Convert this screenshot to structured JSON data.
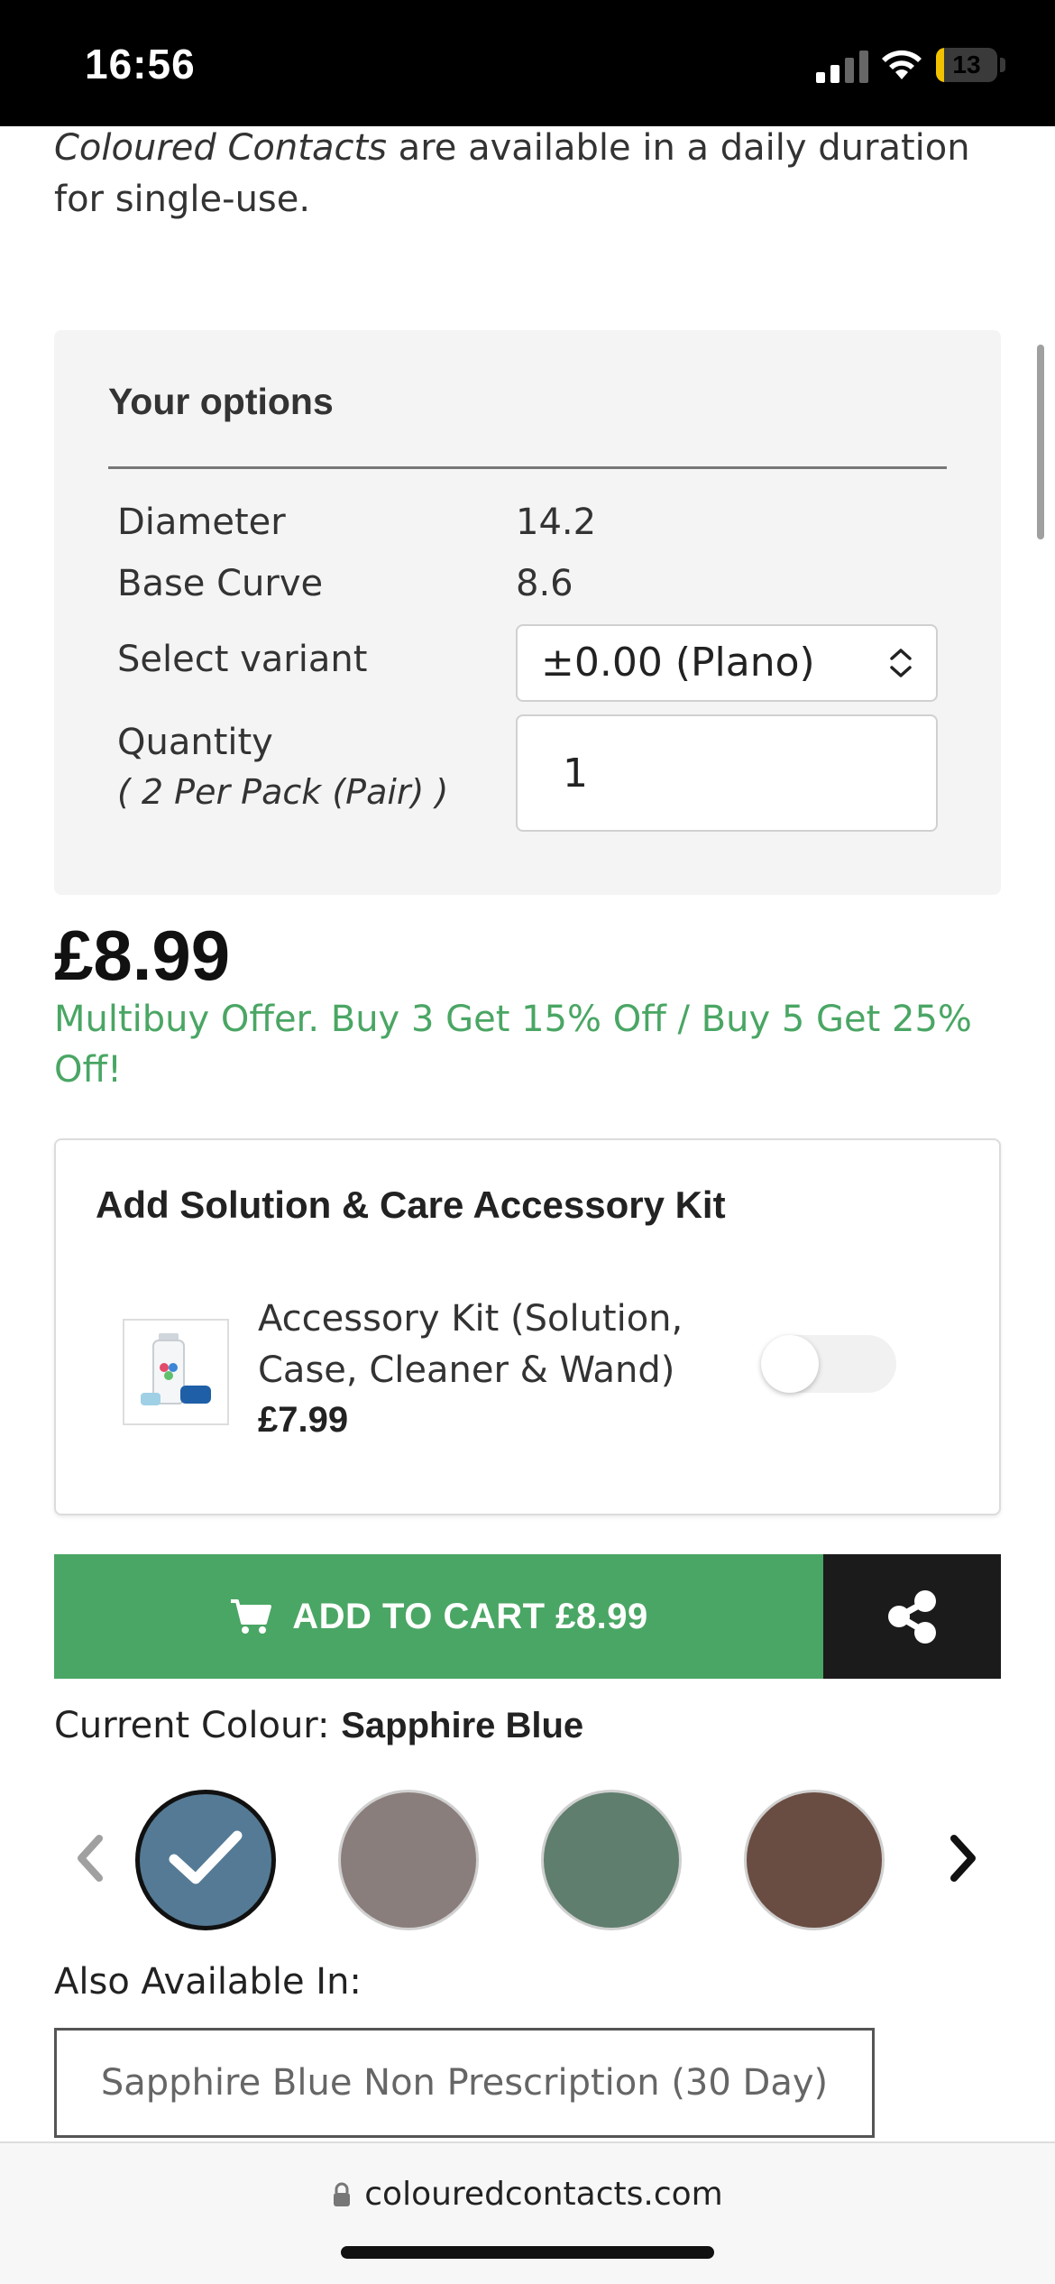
{
  "status_bar": {
    "time": "16:56",
    "battery_level": "13",
    "battery_color": "#f2c200"
  },
  "intro": {
    "brand": "Coloured Contacts",
    "text_line1_rest": " are available in a daily duration",
    "text_line2": "for single-use."
  },
  "options": {
    "title": "Your options",
    "diameter_label": "Diameter",
    "diameter_value": "14.2",
    "base_curve_label": "Base Curve",
    "base_curve_value": "8.6",
    "variant_label": "Select variant",
    "variant_value": "±0.00 (Plano)",
    "quantity_label": "Quantity",
    "quantity_sub": "( 2 Per Pack (Pair) )",
    "quantity_value": "1"
  },
  "pricing": {
    "price": "£8.99",
    "offer_line1": "Multibuy Offer. Buy 3 Get 15% Off / Buy 5 Get 25%",
    "offer_line2": "Off!",
    "offer_color": "#4aa664"
  },
  "accessory": {
    "title": "Add Solution & Care Accessory Kit",
    "name_line1": "Accessory Kit (Solution,",
    "name_line2": "Case, Cleaner & Wand)",
    "price": "£7.99",
    "toggle_on": false
  },
  "actions": {
    "add_to_cart_label": "ADD TO CART £8.99",
    "share_icon": "share-icon",
    "cart_icon": "cart-icon",
    "cart_color": "#4aa664",
    "share_color": "#1b1b1b"
  },
  "colour": {
    "current_label": "Current Colour:",
    "current_value": "Sapphire Blue",
    "swatches": [
      {
        "color": "#557a95",
        "selected": true
      },
      {
        "color": "#8a7e7c",
        "selected": false
      },
      {
        "color": "#5f7e6e",
        "selected": false
      },
      {
        "color": "#6a4d42",
        "selected": false
      }
    ]
  },
  "also_available": {
    "label": "Also Available In:",
    "option": "Sapphire Blue Non Prescription (30 Day)"
  },
  "browser": {
    "url": "colouredcontacts.com"
  }
}
